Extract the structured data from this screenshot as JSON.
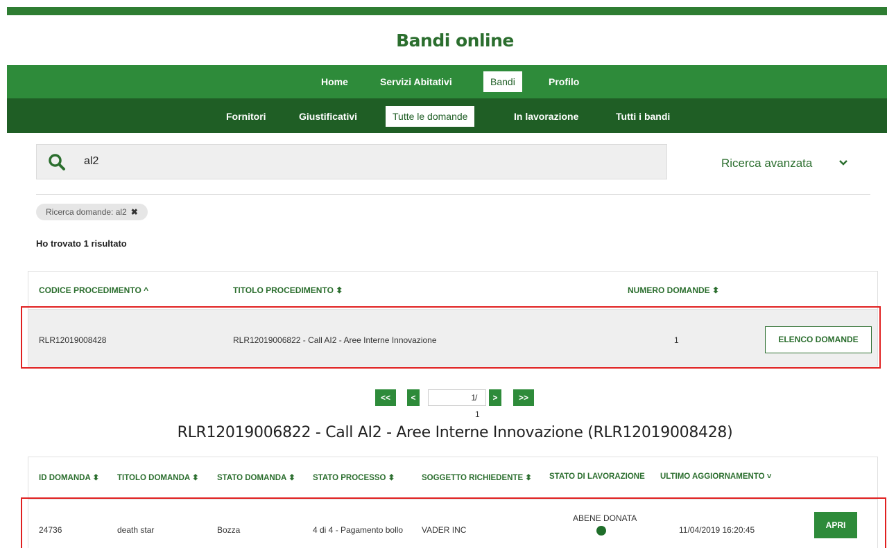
{
  "app": {
    "title": "Bandi online"
  },
  "nav": {
    "primary": [
      "Home",
      "Servizi Abitativi",
      "Bandi",
      "Profilo"
    ],
    "primary_active": "Bandi",
    "secondary": [
      "Fornitori",
      "Giustificativi",
      "Tutte le domande",
      "In lavorazione",
      "Tutti i bandi"
    ],
    "secondary_active": "Tutte le domande"
  },
  "search": {
    "value": "al2",
    "advanced_label": "Ricerca avanzata",
    "icon": "search-icon"
  },
  "filter_chip": {
    "label": "Ricerca domande: al2",
    "close": "✖"
  },
  "results": {
    "count_text": "Ho trovato 1 risultato"
  },
  "procedures_table": {
    "headers": [
      "CODICE PROCEDIMENTO ^",
      "TITOLO PROCEDIMENTO ⬍",
      "NUMERO DOMANDE ⬍"
    ],
    "rows": [
      {
        "codice": "RLR12019008428",
        "titolo": "RLR12019006822 - Call AI2 - Aree Interne Innovazione",
        "numero": "1",
        "button": "ELENCO DOMANDE"
      }
    ]
  },
  "pagination": {
    "first": "<<",
    "prev": "<",
    "current": "1",
    "total": "/ 1",
    "next": ">",
    "last": ">>"
  },
  "applications": {
    "title": "RLR12019006822 - Call AI2 - Aree Interne Innovazione (RLR12019008428)",
    "headers": [
      "ID DOMANDA ⬍",
      "TITOLO DOMANDA ⬍",
      "STATO DOMANDA ⬍",
      "STATO PROCESSO ⬍",
      "SOGGETTO RICHIEDENTE ⬍",
      "STATO DI LAVORAZIONE",
      "ULTIMO AGGIORNAMENTO ˅"
    ],
    "rows": [
      {
        "id": "24736",
        "titolo": "death star",
        "stato_domanda": "Bozza",
        "stato_processo": "4 di 4 - Pagamento bollo",
        "soggetto": "VADER INC",
        "stato_lavorazione": "ABENE DONATA",
        "ultimo": "11/04/2019 16:20:45",
        "button": "APRI"
      }
    ]
  },
  "colors": {
    "primary_green": "#2e8b3a",
    "dark_green": "#1f5e25",
    "highlight_red": "#e02020"
  }
}
